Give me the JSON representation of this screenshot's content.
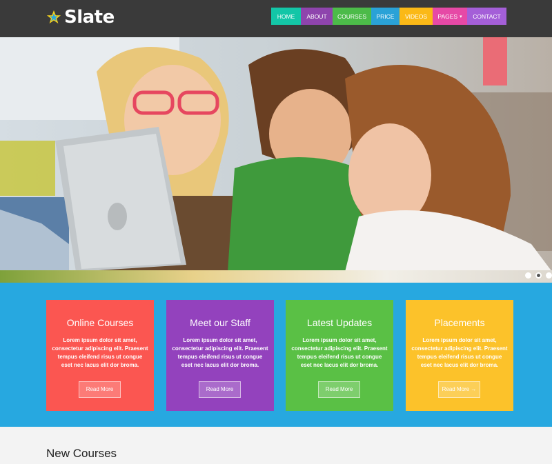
{
  "brand": {
    "name": "Slate"
  },
  "nav": [
    {
      "label": "HOME",
      "color": "#13c6a7"
    },
    {
      "label": "ABOUT",
      "color": "#8e44ad"
    },
    {
      "label": "COURSES",
      "color": "#4cbb49"
    },
    {
      "label": "PRICE",
      "color": "#2aa2d7"
    },
    {
      "label": "VIDEOS",
      "color": "#fbb917"
    },
    {
      "label": "PAGES",
      "color": "#e649a6",
      "dropdown": true
    },
    {
      "label": "CONTACT",
      "color": "#a45fd8"
    }
  ],
  "slider": {
    "slides": 3,
    "active_index": 1
  },
  "features": [
    {
      "title": "Online Courses",
      "text": "Lorem ipsum dolor sit amet, consectetur adipiscing elit. Praesent tempus eleifend risus ut congue eset nec lacus elit dor broma.",
      "button": "Read More",
      "color": "#fb5651"
    },
    {
      "title": "Meet our Staff",
      "text": "Lorem ipsum dolor sit amet, consectetur adipiscing elit. Praesent tempus eleifend risus ut congue eset nec lacus elit dor broma.",
      "button": "Read More",
      "color": "#9342bd"
    },
    {
      "title": "Latest Updates",
      "text": "Lorem ipsum dolor sit amet, consectetur adipiscing elit. Praesent tempus eleifend risus ut congue eset nec lacus elit dor broma.",
      "button": "Read More",
      "color": "#5ac045"
    },
    {
      "title": "Placements",
      "text": "Lorem ipsum dolor sit amet, consectetur adipiscing elit. Praesent tempus eleifend risus ut congue eset nec lacus elit dor broma.",
      "button": "Read More →",
      "color": "#fcc22a"
    }
  ],
  "section": {
    "title": "New Courses"
  },
  "colors": {
    "header_bg": "#3a3a3a",
    "features_bg": "#27a8e0"
  }
}
